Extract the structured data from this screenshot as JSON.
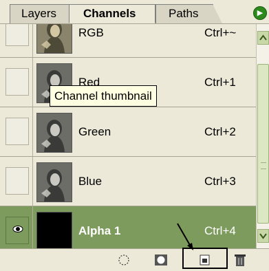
{
  "tabs": [
    {
      "label": "Layers",
      "active": false
    },
    {
      "label": "Channels",
      "active": true
    },
    {
      "label": "Paths",
      "active": false
    }
  ],
  "channels": [
    {
      "name": "RGB",
      "shortcut": "Ctrl+~",
      "visible": false,
      "selected": false,
      "thumbnail": "portrait-sepia"
    },
    {
      "name": "Red",
      "shortcut": "Ctrl+1",
      "visible": false,
      "selected": false,
      "thumbnail": "portrait-gray"
    },
    {
      "name": "Green",
      "shortcut": "Ctrl+2",
      "visible": false,
      "selected": false,
      "thumbnail": "portrait-gray"
    },
    {
      "name": "Blue",
      "shortcut": "Ctrl+3",
      "visible": false,
      "selected": false,
      "thumbnail": "portrait-gray"
    },
    {
      "name": "Alpha 1",
      "shortcut": "Ctrl+4",
      "visible": true,
      "selected": true,
      "thumbnail": "black"
    }
  ],
  "tooltip": {
    "text": "Channel thumbnail"
  },
  "icons": {
    "panel_menu": "arrow-right-icon",
    "visibility": "eye-icon",
    "load_selection": "dotted-circle-icon",
    "save_selection": "mask-icon",
    "new_channel": "new-page-icon",
    "delete": "trash-icon"
  },
  "colors": {
    "selected_row": "#7e9b5e",
    "panel_bg": "#ece9d8",
    "tooltip_bg": "#ffffe1",
    "scrollbar": "#c8d8a8"
  }
}
